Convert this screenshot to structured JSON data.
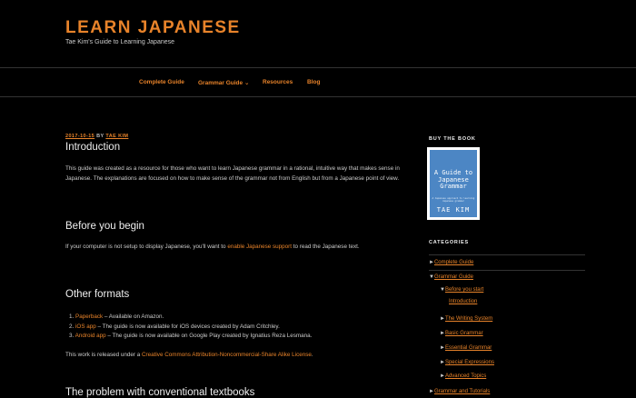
{
  "header": {
    "title": "LEARN JAPANESE",
    "description": "Tae Kim's Guide to Learning Japanese"
  },
  "nav": {
    "items": [
      "Complete Guide",
      "Grammar Guide",
      "Resources",
      "Blog"
    ],
    "dropdown_glyph": "⌄"
  },
  "post": {
    "date": "2017-10-15",
    "by": "BY",
    "author": "TAE KIM",
    "title": "Introduction",
    "intro_paragraph": "This guide was created as a resource for those who want to learn Japanese grammar in a rational, intuitive way that makes sense in Japanese. The explanations are focused on how to make sense of the grammar not from English but from a Japanese point of view.",
    "sections": {
      "before_heading": "Before you begin",
      "before_text_1": "If your computer is not setup to display Japanese, you'll want to ",
      "before_link": "enable Japanese support",
      "before_text_2": " to read the Japanese text.",
      "formats_heading": "Other formats",
      "formats": [
        {
          "num": "1.",
          "link": "Paperback",
          "text": " – Available on Amazon."
        },
        {
          "num": "2.",
          "link": "iOS app",
          "text": " – The guide is now available for iOS devices created by Adam Critchley."
        },
        {
          "num": "3.",
          "link": "Android app",
          "text": " – The guide is now available on Google Play created by Ignatius Reza Lesmana."
        }
      ],
      "license_text": "This work is released under a ",
      "license_link": "Creative Commons Attribution-Noncommercial-Share Alike License",
      "license_end": ".",
      "next_heading": "The problem with conventional textbooks"
    }
  },
  "sidebar": {
    "buy_heading": "BUY THE BOOK",
    "book": {
      "title": "A Guide to Japanese Grammar",
      "subtitle": "A Japanese approach to learning Japanese grammar",
      "author": "TAE KIM",
      "cover_color": "#4c86c4"
    },
    "categories_heading": "CATEGORIES",
    "categories": [
      {
        "marker": "►",
        "label": "Complete Guide"
      },
      {
        "marker": "▼",
        "label": "Grammar Guide"
      },
      {
        "marker": "▼",
        "label": "Before you start"
      },
      {
        "marker": "",
        "label": "Introduction"
      },
      {
        "marker": "►",
        "label": "The Writing System"
      },
      {
        "marker": "►",
        "label": "Basic Grammar"
      },
      {
        "marker": "►",
        "label": "Essential Grammar"
      },
      {
        "marker": "►",
        "label": "Special Expressions"
      },
      {
        "marker": "►",
        "label": "Advanced Topics"
      },
      {
        "marker": "►",
        "label": "Grammar and Tutorials"
      }
    ]
  },
  "colors": {
    "accent": "#e8832a",
    "background": "#000000"
  }
}
